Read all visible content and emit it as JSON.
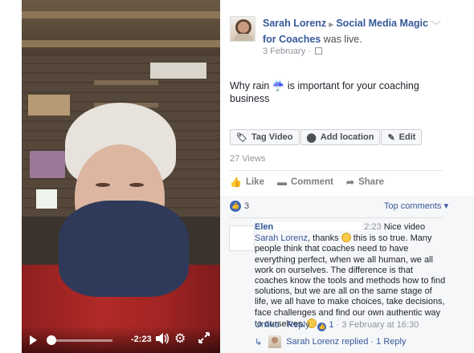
{
  "video": {
    "time_remaining": "-2:23",
    "progress_fraction": 0.05,
    "icons": {
      "play": "play-icon",
      "volume": "volume-icon",
      "settings": "gear-icon",
      "fullscreen": "fullscreen-icon"
    }
  },
  "post": {
    "author": "Sarah Lorenz",
    "group": "Social Media Magic for Coaches",
    "action": "was live.",
    "date": "3 February",
    "separator": "·",
    "status_before": "Why rain",
    "status_after": "is important for your coaching business",
    "tag_buttons": [
      {
        "label": "Tag Video",
        "icon": "tag-icon"
      },
      {
        "label": "Add location",
        "icon": "location-pin-icon"
      },
      {
        "label": "Edit",
        "icon": "pencil-icon"
      }
    ],
    "views": "27 Views",
    "actions": [
      {
        "label": "Like",
        "icon": "thumbs-up-icon"
      },
      {
        "label": "Comment",
        "icon": "comment-icon"
      },
      {
        "label": "Share",
        "icon": "share-icon"
      }
    ]
  },
  "comments_section": {
    "like_count": "3",
    "sort_label": "Top comments",
    "comment": {
      "author": "Elen",
      "time": "2:23",
      "text_1": "Nice video",
      "mention": "Sarah Lorenz",
      "text_2": ", thanks",
      "text_3": "this is so true. Many people think that coaches need to have everything perfect, when we all human, we all work on ourselves. The difference is that coaches know the tools and methods how to find solutions, but we are all on the same stage of life, we all have to make choices, take decisions, face challenges and find our own authentic way to ourselves.",
      "like_label": "Unlike",
      "reply_label": "Reply",
      "reaction_count": "1",
      "timestamp": "3 February at 16:30"
    },
    "reply_summary": {
      "author": "Sarah Lorenz",
      "text": "replied",
      "separator": "·",
      "count_label": "1 Reply"
    }
  },
  "colors": {
    "link_blue": "#365899",
    "like_blue": "#4267b2",
    "muted_gray": "#90949c",
    "comment_bg": "#f6f7f9"
  }
}
